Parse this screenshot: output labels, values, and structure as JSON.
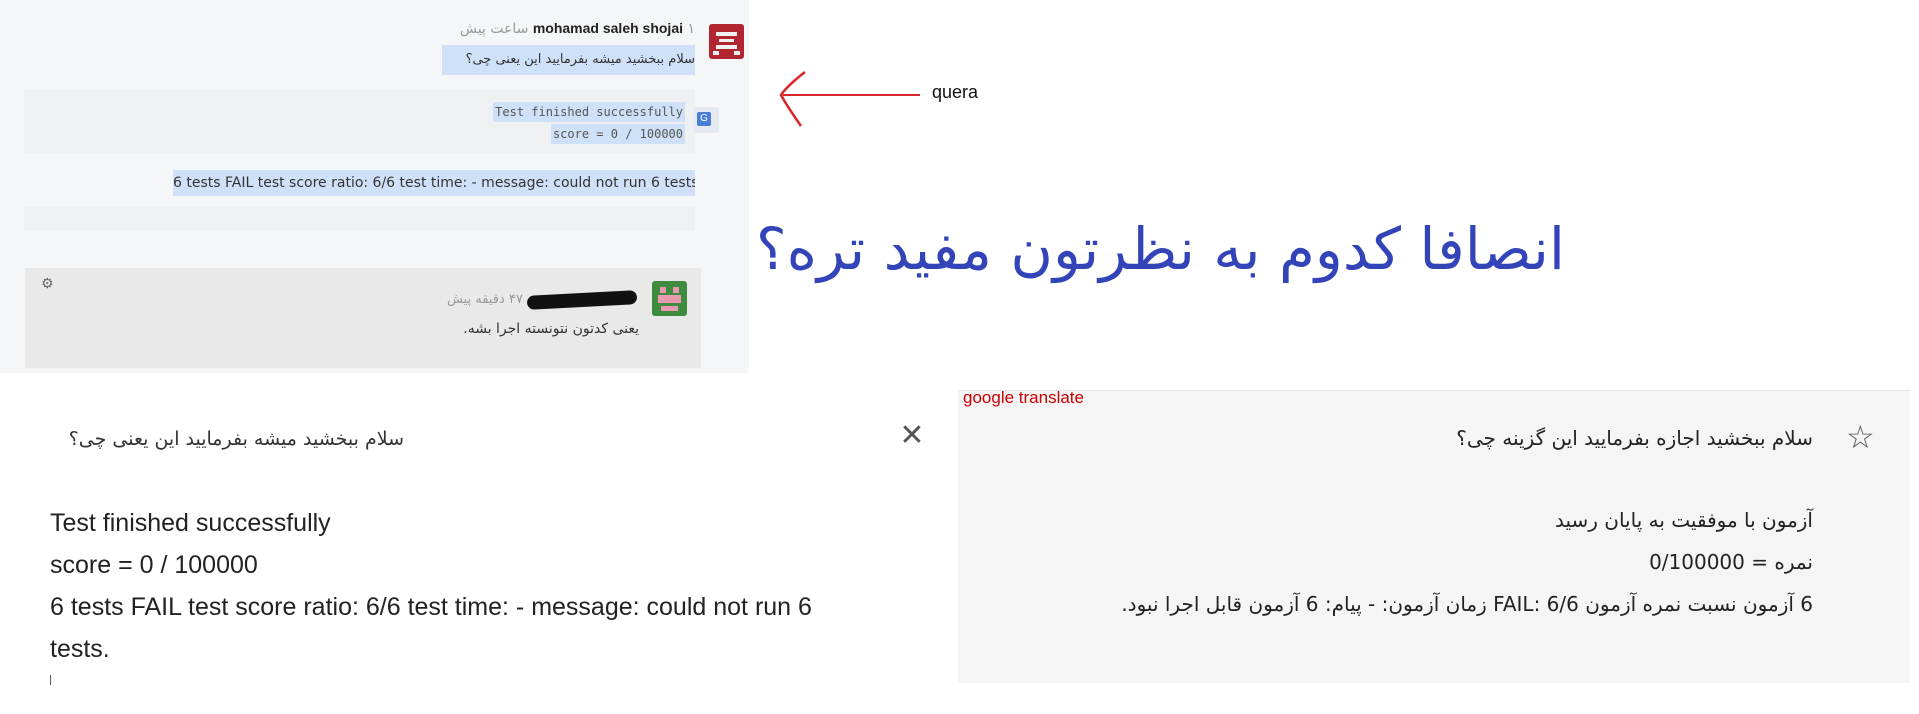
{
  "quera": {
    "author": "mohamad saleh shojai",
    "time": "۱ ساعت پیش",
    "question": "سلام ببخشید میشه بفرمایید این یعنی چی؟",
    "code_lines": [
      "Test finished successfully",
      "score = 0 / 100000"
    ],
    "fail_line": "6 tests FAIL test score ratio: 6/6 test time: - message: could not run 6 tests.",
    "reply_time": "۴۷ دقیقه پیش",
    "reply_text": "یعنی کدتون نتونسته اجرا بشه."
  },
  "annotation": {
    "label": "quera",
    "question": "انصافا کدوم به نظرتون مفید تره؟"
  },
  "source": {
    "question": "سلام ببخشید میشه بفرمایید این یعنی چی؟",
    "lines": [
      "Test finished successfully",
      "score = 0 / 100000",
      "6 tests FAIL test score ratio: 6/6 test time: - message: could not run 6",
      "tests."
    ]
  },
  "translate": {
    "label": "google translate",
    "lines": [
      "سلام ببخشید اجازه بفرمایید این گزینه چی؟",
      "آزمون با موفقیت به پایان رسید",
      "نمره = 0/100000",
      "6 آزمون نسبت نمره آزمون 6/6 :FAIL زمان آزمون: - پیام: 6 آزمون قابل اجرا نبود."
    ]
  },
  "colors": {
    "selection": "#cfe1f8",
    "arrow": "#d9262b",
    "annotation_text": "#3344b8",
    "gt_label": "#cc0000"
  },
  "icons": [
    "gear-icon",
    "translate-icon",
    "close-icon",
    "star-icon"
  ]
}
